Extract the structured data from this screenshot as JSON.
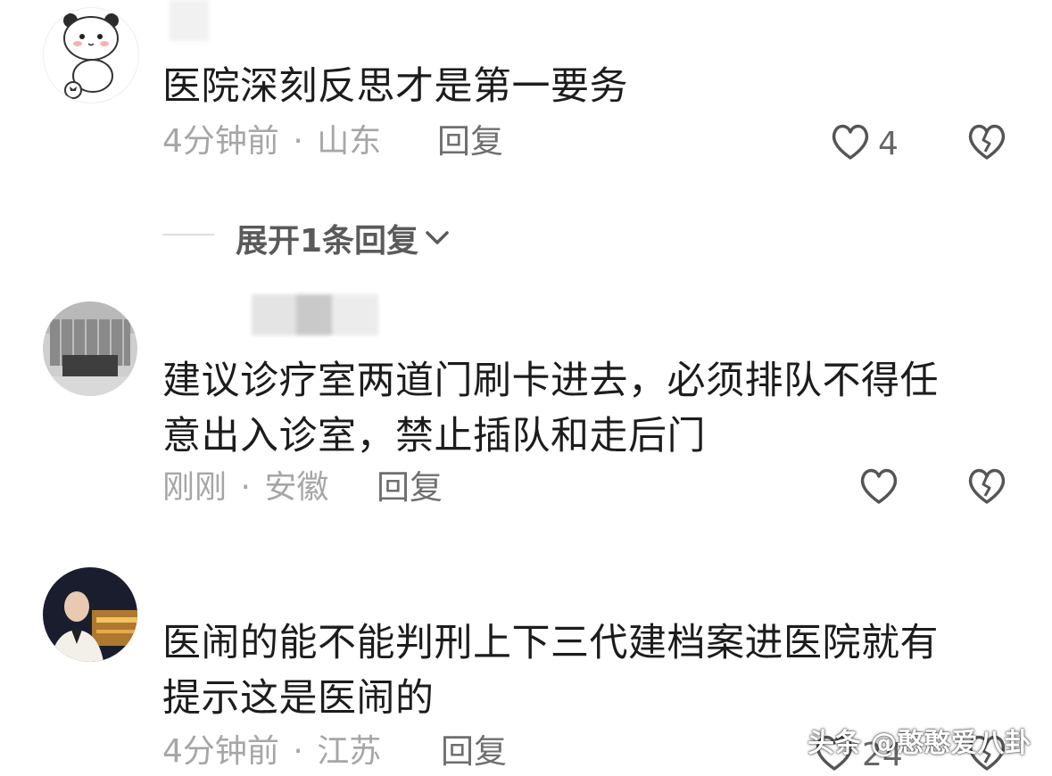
{
  "comments": [
    {
      "text": "医院深刻反思才是第一要务",
      "time": "4分钟前",
      "location": "山东",
      "separator": "·",
      "reply_label": "回复",
      "likes": "4",
      "expand_label": "展开1条回复"
    },
    {
      "text_line1": "建议诊疗室两道门刷卡进去，必须排队不得任",
      "text_line2": "意出入诊室，禁止插队和走后门",
      "time": "刚刚",
      "location": "安徽",
      "separator": "·",
      "reply_label": "回复",
      "likes": ""
    },
    {
      "text_line1": "医闹的能不能判刑上下三代建档案进医院就有",
      "text_line2": "提示这是医闹的",
      "time": "4分钟前",
      "location": "江苏",
      "separator": "·",
      "reply_label": "回复",
      "likes": "24"
    }
  ],
  "watermark": "头条 @憨憨爱八卦",
  "icons": {
    "like": "heart-outline-icon",
    "dislike": "broken-heart-icon",
    "expand": "chevron-down-icon"
  },
  "colors": {
    "text": "#1c1c1c",
    "meta": "#a6a6a6",
    "reply": "#6f6f6f"
  }
}
